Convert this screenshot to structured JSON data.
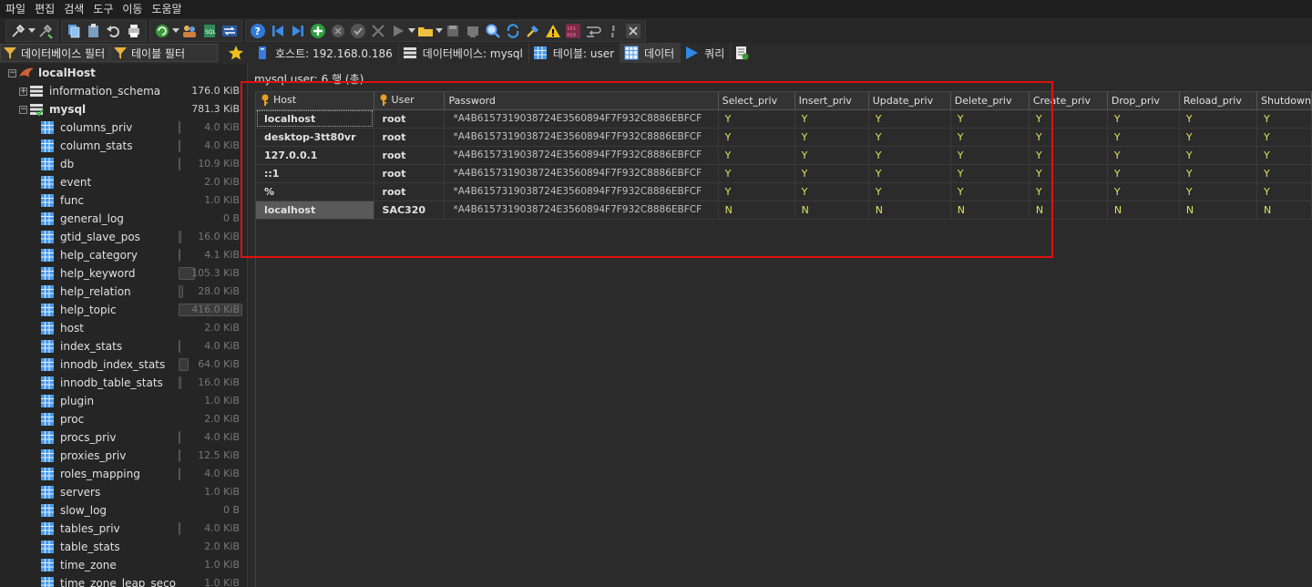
{
  "menu": [
    "파일",
    "편집",
    "검색",
    "도구",
    "이동",
    "도움말"
  ],
  "filters": {
    "database_filter": "데이터베이스 필터",
    "table_filter": "테이블 필터"
  },
  "tabs": [
    {
      "label": "호스트: 192.168.0.186",
      "icon": "server-icon"
    },
    {
      "label": "데이터베이스: mysql",
      "icon": "database-icon"
    },
    {
      "label": "테이블: user",
      "icon": "table-icon"
    },
    {
      "label": "데이터",
      "icon": "grid-icon"
    },
    {
      "label": "쿼리",
      "icon": "play-icon"
    }
  ],
  "tree": {
    "root": "localHost",
    "databases": [
      {
        "name": "information_schema",
        "size": "176.0 KiB"
      },
      {
        "name": "mysql",
        "size": "781.3 KiB"
      }
    ],
    "tables": [
      {
        "name": "columns_priv",
        "size": "4.0 KiB",
        "bar": 0.01
      },
      {
        "name": "column_stats",
        "size": "4.0 KiB",
        "bar": 0.01
      },
      {
        "name": "db",
        "size": "10.9 KiB",
        "bar": 0.026
      },
      {
        "name": "event",
        "size": "2.0 KiB",
        "bar": 0
      },
      {
        "name": "func",
        "size": "1.0 KiB",
        "bar": 0
      },
      {
        "name": "general_log",
        "size": "0 B",
        "bar": 0
      },
      {
        "name": "gtid_slave_pos",
        "size": "16.0 KiB",
        "bar": 0.038
      },
      {
        "name": "help_category",
        "size": "4.1 KiB",
        "bar": 0.01
      },
      {
        "name": "help_keyword",
        "size": "105.3 KiB",
        "bar": 0.25
      },
      {
        "name": "help_relation",
        "size": "28.0 KiB",
        "bar": 0.067
      },
      {
        "name": "help_topic",
        "size": "416.0 KiB",
        "bar": 1.0
      },
      {
        "name": "host",
        "size": "2.0 KiB",
        "bar": 0
      },
      {
        "name": "index_stats",
        "size": "4.0 KiB",
        "bar": 0.01
      },
      {
        "name": "innodb_index_stats",
        "size": "64.0 KiB",
        "bar": 0.154
      },
      {
        "name": "innodb_table_stats",
        "size": "16.0 KiB",
        "bar": 0.038
      },
      {
        "name": "plugin",
        "size": "1.0 KiB",
        "bar": 0
      },
      {
        "name": "proc",
        "size": "2.0 KiB",
        "bar": 0
      },
      {
        "name": "procs_priv",
        "size": "4.0 KiB",
        "bar": 0.01
      },
      {
        "name": "proxies_priv",
        "size": "12.5 KiB",
        "bar": 0.03
      },
      {
        "name": "roles_mapping",
        "size": "4.0 KiB",
        "bar": 0.01
      },
      {
        "name": "servers",
        "size": "1.0 KiB",
        "bar": 0
      },
      {
        "name": "slow_log",
        "size": "0 B",
        "bar": 0
      },
      {
        "name": "tables_priv",
        "size": "4.0 KiB",
        "bar": 0.01
      },
      {
        "name": "table_stats",
        "size": "2.0 KiB",
        "bar": 0
      },
      {
        "name": "time_zone",
        "size": "1.0 KiB",
        "bar": 0
      },
      {
        "name": "time_zone_leap_seco",
        "size": "1.0 KiB",
        "bar": 0
      }
    ]
  },
  "grid": {
    "status": "mysql.user: 6 행 (총)",
    "columns": [
      {
        "label": "Host",
        "key": true
      },
      {
        "label": "User",
        "key": true
      },
      {
        "label": "Password",
        "key": false
      },
      {
        "label": "Select_priv",
        "key": false
      },
      {
        "label": "Insert_priv",
        "key": false
      },
      {
        "label": "Update_priv",
        "key": false
      },
      {
        "label": "Delete_priv",
        "key": false
      },
      {
        "label": "Create_priv",
        "key": false
      },
      {
        "label": "Drop_priv",
        "key": false
      },
      {
        "label": "Reload_priv",
        "key": false
      },
      {
        "label": "Shutdown",
        "key": false
      }
    ],
    "rows": [
      [
        "localhost",
        "root",
        "*A4B6157319038724E3560894F7F932C8886EBFCF",
        "Y",
        "Y",
        "Y",
        "Y",
        "Y",
        "Y",
        "Y",
        "Y"
      ],
      [
        "desktop-3tt80vr",
        "root",
        "*A4B6157319038724E3560894F7F932C8886EBFCF",
        "Y",
        "Y",
        "Y",
        "Y",
        "Y",
        "Y",
        "Y",
        "Y"
      ],
      [
        "127.0.0.1",
        "root",
        "*A4B6157319038724E3560894F7F932C8886EBFCF",
        "Y",
        "Y",
        "Y",
        "Y",
        "Y",
        "Y",
        "Y",
        "Y"
      ],
      [
        "::1",
        "root",
        "*A4B6157319038724E3560894F7F932C8886EBFCF",
        "Y",
        "Y",
        "Y",
        "Y",
        "Y",
        "Y",
        "Y",
        "Y"
      ],
      [
        "%",
        "root",
        "*A4B6157319038724E3560894F7F932C8886EBFCF",
        "Y",
        "Y",
        "Y",
        "Y",
        "Y",
        "Y",
        "Y",
        "Y"
      ],
      [
        "localhost",
        "SAC320",
        "*A4B6157319038724E3560894F7F932C8886EBFCF",
        "N",
        "N",
        "N",
        "N",
        "N",
        "N",
        "N",
        "N"
      ]
    ]
  },
  "colors": {
    "highlight": "#e01010",
    "flag": "#e0e060",
    "background": "#2b2b2b"
  }
}
